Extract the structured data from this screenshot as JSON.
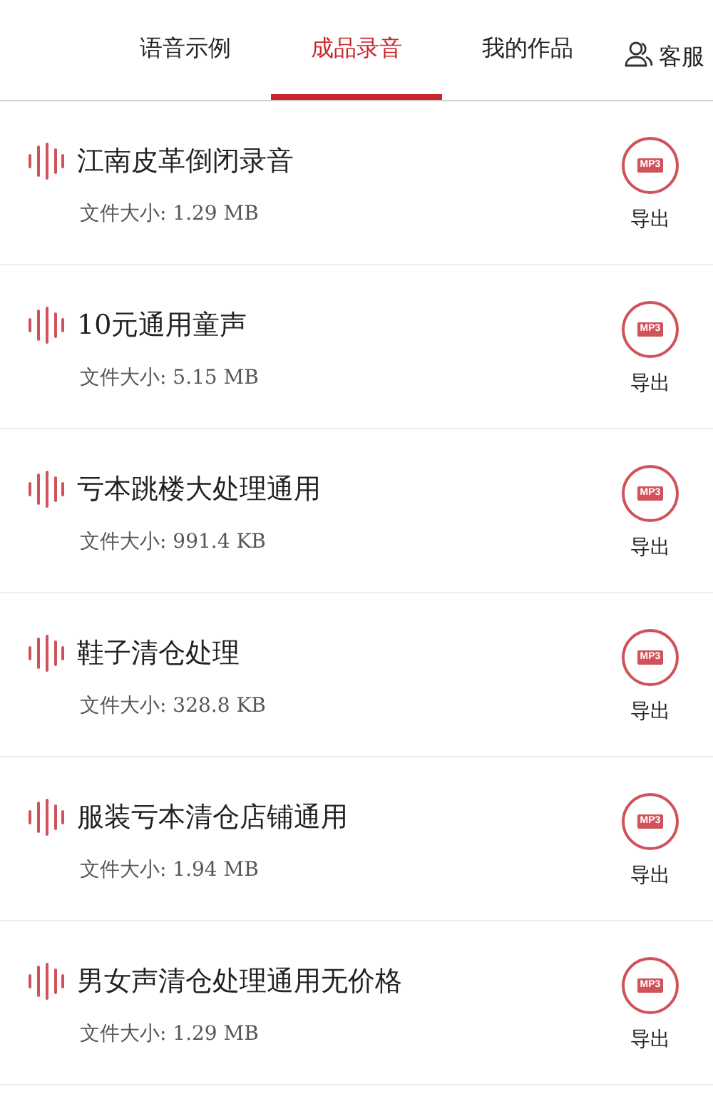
{
  "tabs": [
    {
      "label": "语音示例",
      "selected": false
    },
    {
      "label": "成品录音",
      "selected": true
    },
    {
      "label": "我的作品",
      "selected": false
    }
  ],
  "service": {
    "label": "客服"
  },
  "recordings": [
    {
      "title": "江南皮革倒闭录音",
      "size": "文件大小: 1.29 MB",
      "badge": "MP3",
      "action": "导出"
    },
    {
      "title": "10元通用童声",
      "size": "文件大小: 5.15 MB",
      "badge": "MP3",
      "action": "导出"
    },
    {
      "title": "亏本跳楼大处理通用",
      "size": "文件大小: 991.4 KB",
      "badge": "MP3",
      "action": "导出"
    },
    {
      "title": "鞋子清仓处理",
      "size": "文件大小: 328.8 KB",
      "badge": "MP3",
      "action": "导出"
    },
    {
      "title": "服装亏本清仓店铺通用",
      "size": "文件大小: 1.94 MB",
      "badge": "MP3",
      "action": "导出"
    },
    {
      "title": "男女声清仓处理通用无价格",
      "size": "文件大小: 1.29 MB",
      "badge": "MP3",
      "action": "导出"
    }
  ]
}
